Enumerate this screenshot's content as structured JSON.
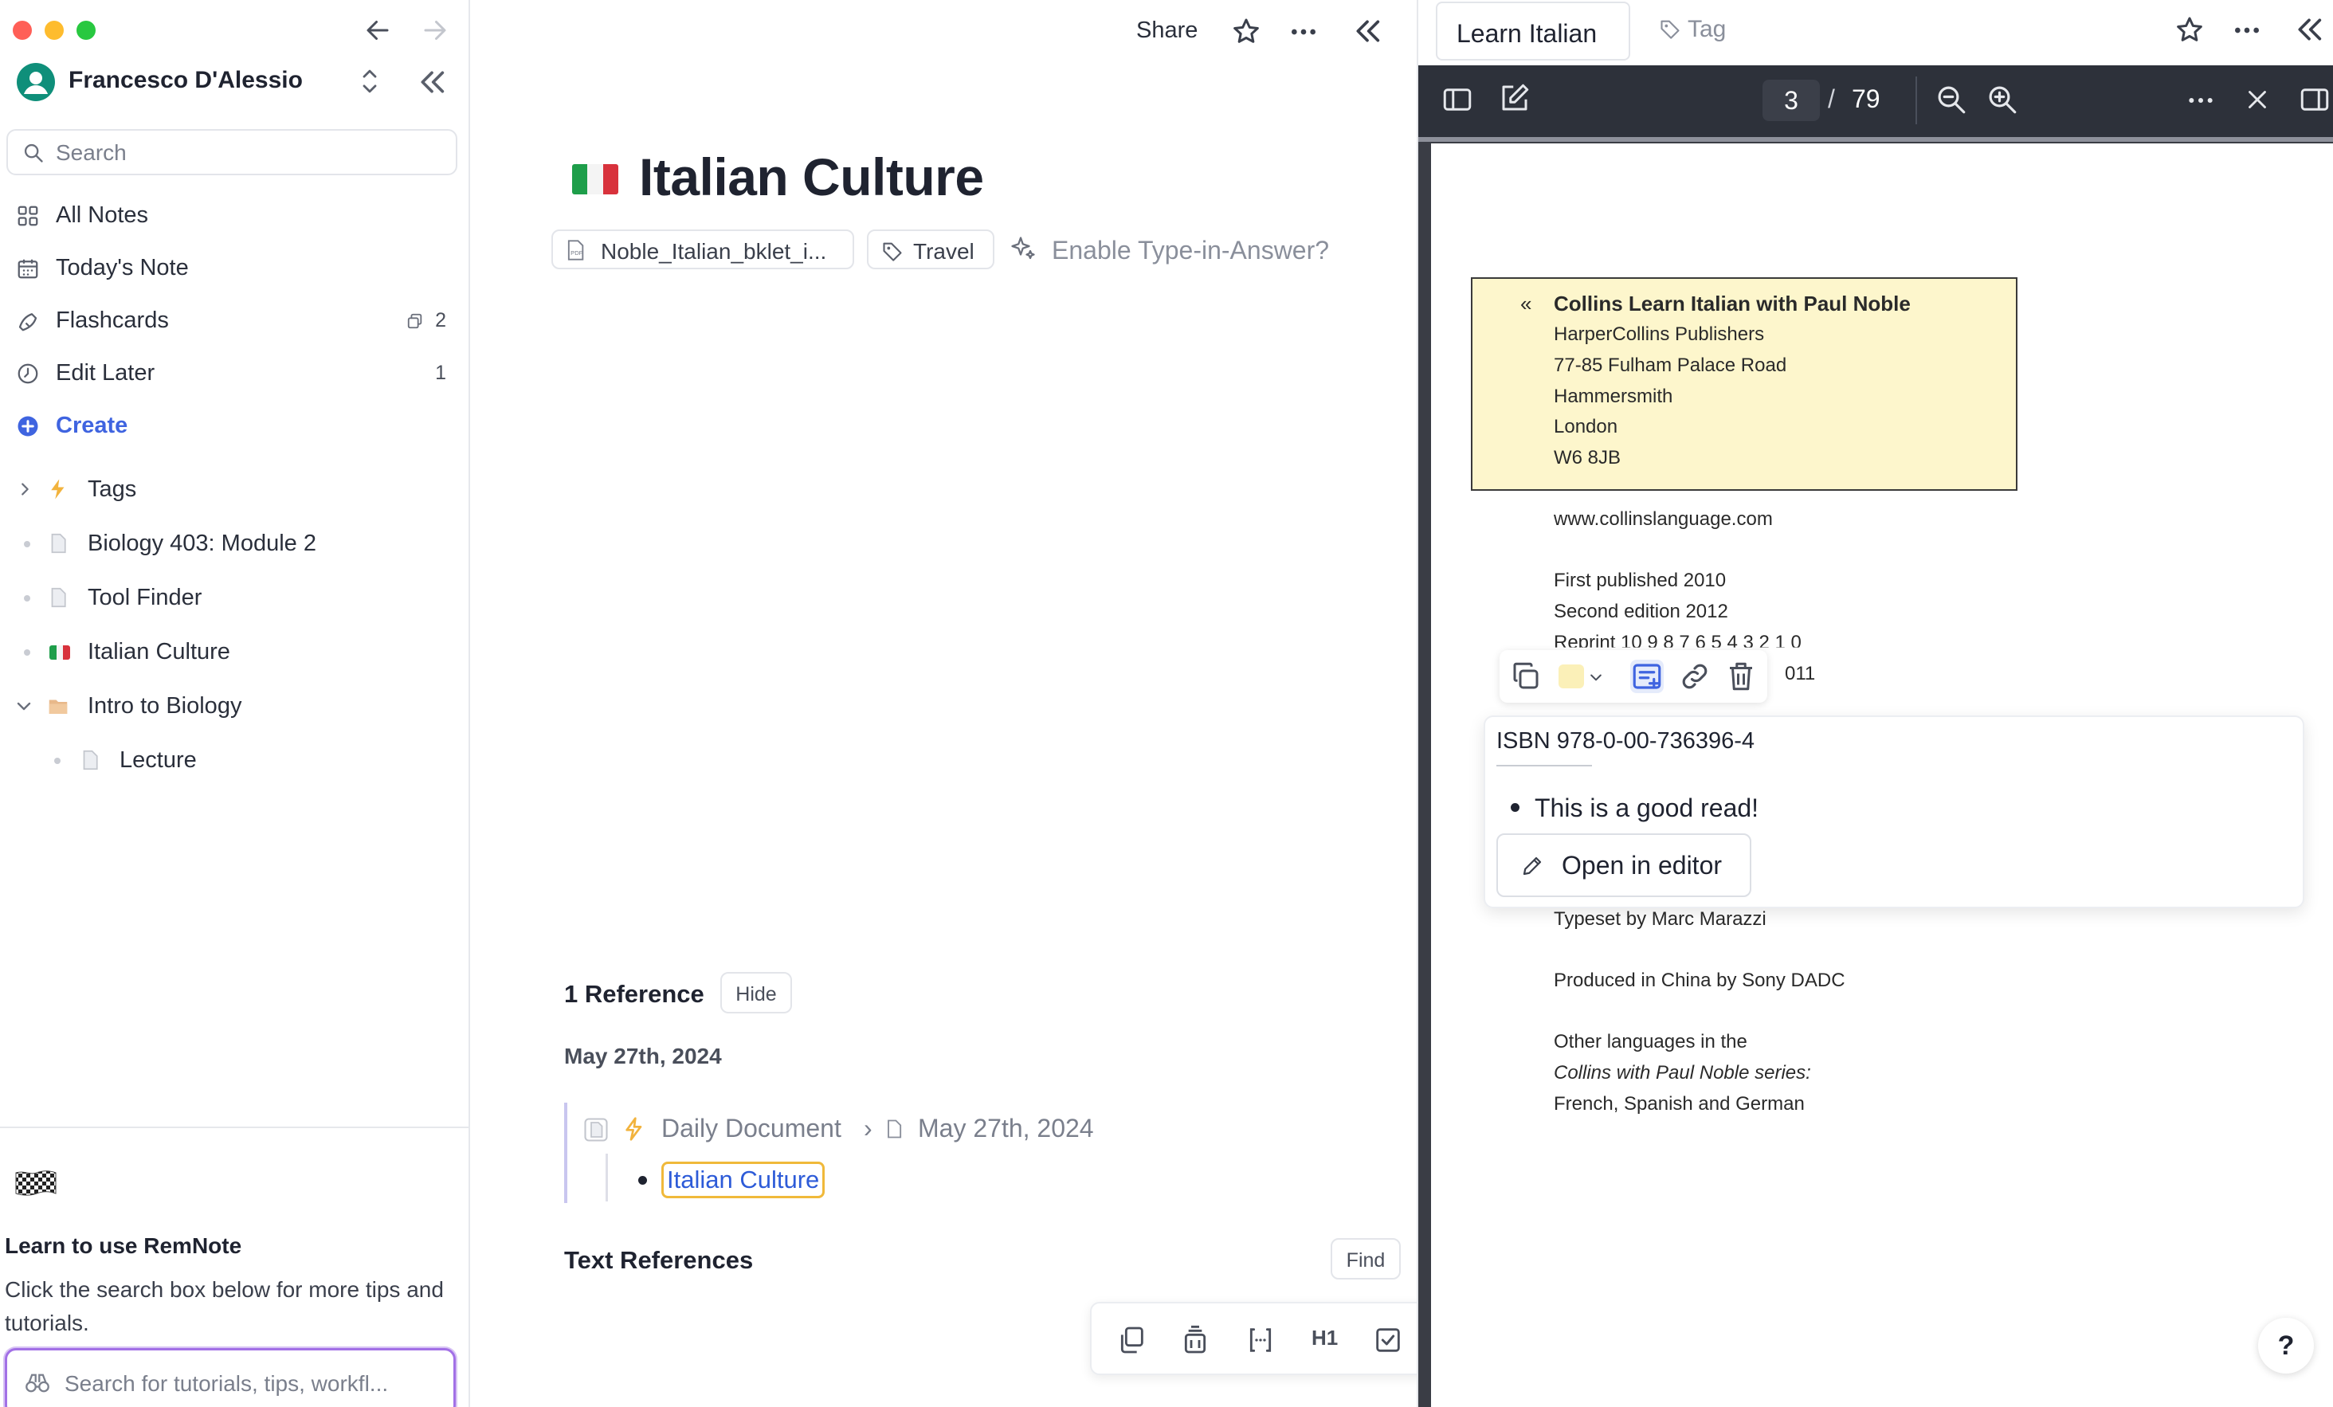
{
  "window": {
    "traffic_colors": [
      "#ff5f57",
      "#febc2e",
      "#28c840"
    ]
  },
  "sidebar": {
    "user_name": "Francesco D'Alessio",
    "search_placeholder": "Search",
    "nav": [
      {
        "label": "All Notes",
        "icon": "grid-icon",
        "badge": ""
      },
      {
        "label": "Today's Note",
        "icon": "calendar-icon",
        "badge": ""
      },
      {
        "label": "Flashcards",
        "icon": "flashcards-icon",
        "badge": "2"
      },
      {
        "label": "Edit Later",
        "icon": "clock-icon",
        "badge": "1"
      }
    ],
    "create_label": "Create",
    "tree": [
      {
        "label": "Tags",
        "icon": "lightning-icon"
      },
      {
        "label": "Biology 403: Module 2",
        "icon": "document-icon"
      },
      {
        "label": "Tool Finder",
        "icon": "document-icon"
      },
      {
        "label": "Italian Culture",
        "icon": "italy-flag-icon"
      },
      {
        "label": "Intro to Biology",
        "icon": "folder-icon"
      },
      {
        "label": "Lecture",
        "icon": "document-icon"
      }
    ],
    "tips": {
      "title": "Learn to use RemNote",
      "description": "Click the search box below for more tips and tutorials.",
      "search_placeholder": "Search for tutorials, tips, workfl..."
    }
  },
  "main": {
    "share_label": "Share",
    "title": "Italian Culture",
    "pill_pdf": "Noble_Italian_bklet_i...",
    "pill_tag": "Travel",
    "enable_type": "Enable Type-in-Answer?",
    "references_title": "1 Reference",
    "hide_label": "Hide",
    "ref_date": "May 27th, 2024",
    "crumb_doc": "Daily Document",
    "crumb_sep": "›",
    "crumb_date": "May 27th, 2024",
    "ref_link": "Italian Culture",
    "text_refs_title": "Text References",
    "find_label": "Find",
    "toolbar_h1": "H1"
  },
  "right": {
    "tab_label": "Learn Italian",
    "tag_label": "Tag",
    "page_current": "3",
    "page_sep": "/",
    "page_total": "79",
    "pdf_lines": {
      "hl_arrow": "«",
      "hl_title": "Collins Learn Italian with Paul Noble",
      "hl_lines": [
        "HarperCollins Publishers",
        "77-85 Fulham Palace Road",
        "Hammersmith",
        "London",
        "W6 8JB"
      ],
      "website": "www.collinslanguage.com",
      "first_published": "First published 2010",
      "second_edition": "Second edition 2012",
      "reprint": "Reprint 10 9 8 7 6 5 4 3 2 1 0",
      "year_fragment": "011",
      "typeset": "Typeset by Marc Marazzi",
      "produced": "Produced in China by Sony DADC",
      "other_1": "Other languages in the",
      "other_2": "Collins with Paul Noble series:",
      "other_3": "French, Spanish and German"
    },
    "note": {
      "isbn": "ISBN 978-0-00-736396-4",
      "bullet": "This is a good read!",
      "open_editor": "Open in editor"
    },
    "help_label": "?"
  }
}
